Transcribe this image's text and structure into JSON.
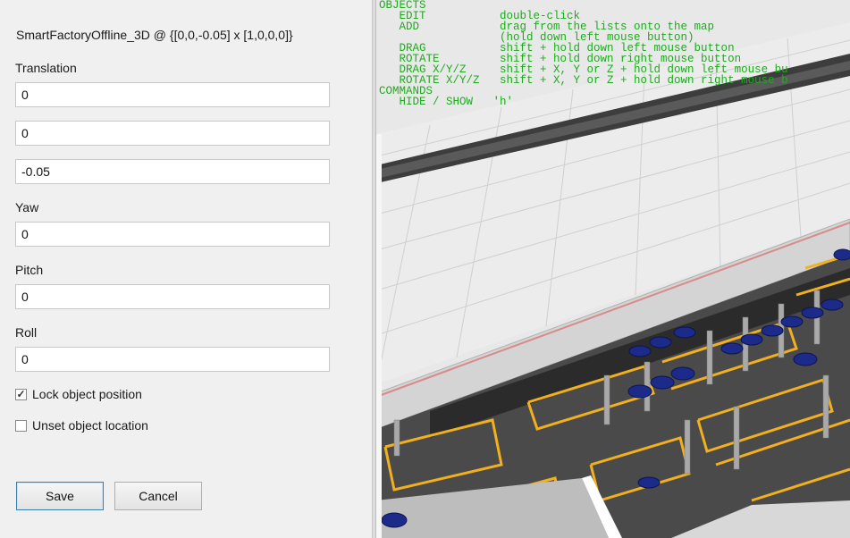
{
  "dialog": {
    "title": "SmartFactoryOffline_3D @ {[0,0,-0.05] x [1,0,0,0]}",
    "translation_label": "Translation",
    "translation_x": "0",
    "translation_y": "0",
    "translation_z": "-0.05",
    "yaw_label": "Yaw",
    "yaw_value": "0",
    "pitch_label": "Pitch",
    "pitch_value": "0",
    "roll_label": "Roll",
    "roll_value": "0",
    "lock_label": "Lock object position",
    "lock_checked": true,
    "unset_label": "Unset object location",
    "unset_checked": false,
    "save_label": "Save",
    "cancel_label": "Cancel"
  },
  "help_overlay": {
    "lines": [
      "OBJECTS",
      "   EDIT           double-click",
      "   ADD            drag from the lists onto the map",
      "                  (hold down left mouse button)",
      "   DRAG           shift + hold down left mouse button",
      "   ROTATE         shift + hold down right mouse button",
      "   DRAG X/Y/Z     shift + X, Y or Z + hold down left mouse bu",
      "   ROTATE X/Y/Z   shift + X, Y or Z + hold down right mouse b",
      "COMMANDS",
      "   HIDE / SHOW   'h'"
    ]
  },
  "colors": {
    "overlay_text": "#1faa1f",
    "lane_yellow": "#f2b01e",
    "floor_dark": "#3a3a3a",
    "vehicle_blue": "#1c2a8a"
  }
}
